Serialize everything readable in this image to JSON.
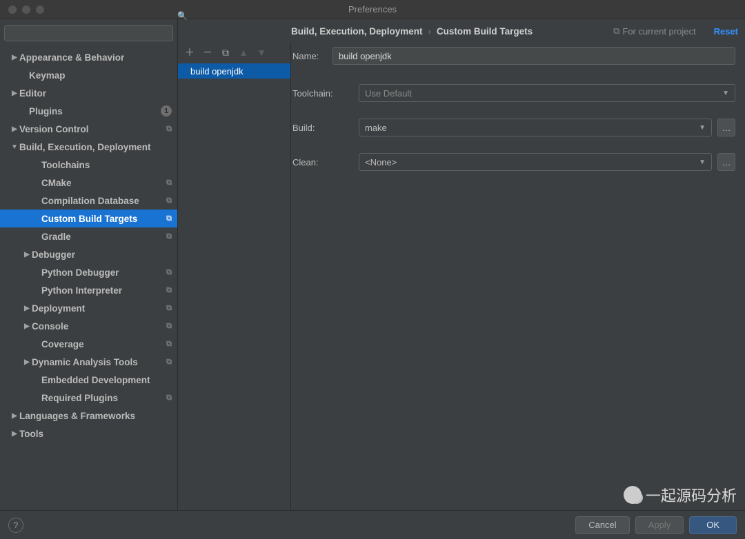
{
  "window": {
    "title": "Preferences"
  },
  "search": {
    "placeholder": ""
  },
  "sidebar": {
    "items": [
      {
        "label": "Appearance & Behavior",
        "indent": 14,
        "arrow": "▶",
        "badge": ""
      },
      {
        "label": "Keymap",
        "indent": 28,
        "arrow": "",
        "badge": ""
      },
      {
        "label": "Editor",
        "indent": 14,
        "arrow": "▶",
        "badge": ""
      },
      {
        "label": "Plugins",
        "indent": 28,
        "arrow": "",
        "badge": "count",
        "count": "1"
      },
      {
        "label": "Version Control",
        "indent": 14,
        "arrow": "▶",
        "badge": "copy"
      },
      {
        "label": "Build, Execution, Deployment",
        "indent": 14,
        "arrow": "▼",
        "badge": ""
      },
      {
        "label": "Toolchains",
        "indent": 46,
        "arrow": "",
        "badge": ""
      },
      {
        "label": "CMake",
        "indent": 46,
        "arrow": "",
        "badge": "copy"
      },
      {
        "label": "Compilation Database",
        "indent": 46,
        "arrow": "",
        "badge": "copy"
      },
      {
        "label": "Custom Build Targets",
        "indent": 46,
        "arrow": "",
        "badge": "copy",
        "selected": true
      },
      {
        "label": "Gradle",
        "indent": 46,
        "arrow": "",
        "badge": "copy"
      },
      {
        "label": "Debugger",
        "indent": 32,
        "arrow": "▶",
        "badge": ""
      },
      {
        "label": "Python Debugger",
        "indent": 46,
        "arrow": "",
        "badge": "copy"
      },
      {
        "label": "Python Interpreter",
        "indent": 46,
        "arrow": "",
        "badge": "copy"
      },
      {
        "label": "Deployment",
        "indent": 32,
        "arrow": "▶",
        "badge": "copy"
      },
      {
        "label": "Console",
        "indent": 32,
        "arrow": "▶",
        "badge": "copy"
      },
      {
        "label": "Coverage",
        "indent": 46,
        "arrow": "",
        "badge": "copy"
      },
      {
        "label": "Dynamic Analysis Tools",
        "indent": 32,
        "arrow": "▶",
        "badge": "copy"
      },
      {
        "label": "Embedded Development",
        "indent": 46,
        "arrow": "",
        "badge": ""
      },
      {
        "label": "Required Plugins",
        "indent": 46,
        "arrow": "",
        "badge": "copy"
      },
      {
        "label": "Languages & Frameworks",
        "indent": 14,
        "arrow": "▶",
        "badge": ""
      },
      {
        "label": "Tools",
        "indent": 14,
        "arrow": "▶",
        "badge": ""
      }
    ]
  },
  "breadcrumb": {
    "a": "Build, Execution, Deployment",
    "b": "Custom Build Targets"
  },
  "scope": {
    "label": "For current project"
  },
  "reset": "Reset",
  "targets": [
    {
      "name": "build openjdk"
    }
  ],
  "form": {
    "name_label": "Name:",
    "name_value": "build openjdk",
    "toolchain_label": "Toolchain:",
    "toolchain_value": "Use Default",
    "build_label": "Build:",
    "build_value": "make",
    "clean_label": "Clean:",
    "clean_value": "<None>"
  },
  "footer": {
    "cancel": "Cancel",
    "apply": "Apply",
    "ok": "OK"
  },
  "watermark": "一起源码分析"
}
